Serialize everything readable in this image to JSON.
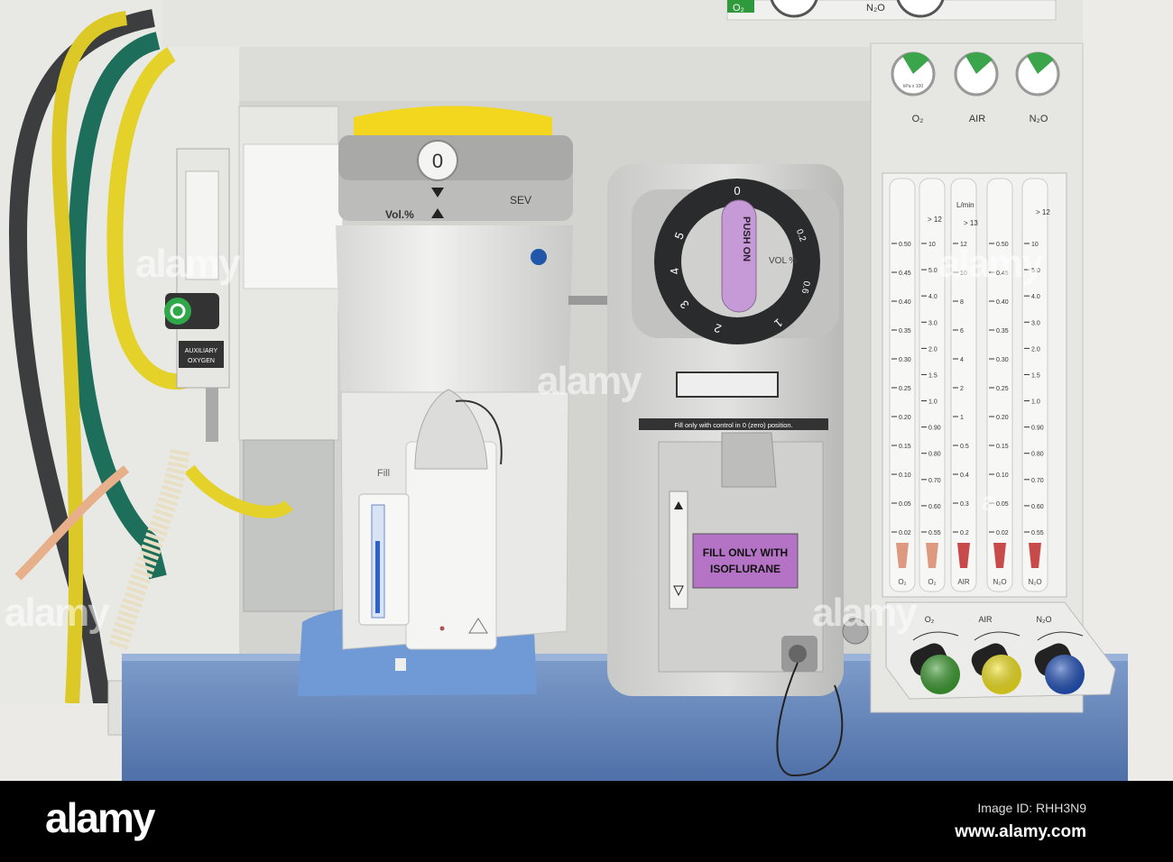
{
  "top_panel": {
    "gauge_labels": [
      "O₂",
      "N₂O"
    ]
  },
  "pipeline_gauges": {
    "labels": [
      "O₂",
      "AIR",
      "N₂O"
    ],
    "unit_text": "kPa x 100"
  },
  "aux_oxygen": {
    "label_line1": "AUXILIARY",
    "label_line2": "OXYGEN"
  },
  "sev_vaporizer": {
    "dial_value": "0",
    "vol_label": "Vol.%",
    "agent": "SEV",
    "fill_label": "Fill"
  },
  "iso_vaporizer": {
    "knob_label": "PUSH ON",
    "vol_label": "VOL %",
    "dial_numbers": [
      "0",
      "0.2",
      "0.6",
      "1",
      "2",
      "3",
      "4",
      "5"
    ],
    "fill_instruction": "Fill only with control in 0 (zero) position.",
    "agent_label_line1": "FILL ONLY WITH",
    "agent_label_line2": "ISOFLURANE"
  },
  "flowmeters": {
    "unit": "L/min",
    "top_marks": [
      "> 12",
      "> 13",
      "> 12"
    ],
    "tube_labels": [
      "O₂",
      "O₂",
      "AIR",
      "N₂O",
      "N₂O"
    ],
    "scales": [
      [
        "0.50",
        "0.45",
        "0.40",
        "0.35",
        "0.30",
        "0.25",
        "0.20",
        "0.15",
        "0.10",
        "0.05",
        "0.02"
      ],
      [
        "10",
        "5.0",
        "4.0",
        "3.0",
        "2.0",
        "1.5",
        "1.0",
        "0.90",
        "0.80",
        "0.70",
        "0.60",
        "0.55"
      ],
      [
        "12",
        "10",
        "8",
        "6",
        "4",
        "2",
        "1",
        "0.5",
        "0.4",
        "0.3",
        "0.2"
      ],
      [
        "0.50",
        "0.45",
        "0.40",
        "0.35",
        "0.30",
        "0.25",
        "0.20",
        "0.15",
        "0.10",
        "0.05",
        "0.02"
      ],
      [
        "10",
        "5.0",
        "4.0",
        "3.0",
        "2.0",
        "1.5",
        "1.0",
        "0.90",
        "0.80",
        "0.70",
        "0.60",
        "0.55"
      ]
    ]
  },
  "flow_knobs": {
    "labels": [
      "O₂",
      "AIR",
      "N₂O"
    ],
    "colors": [
      "#3a9a2e",
      "#f2e21a",
      "#1f4fb8"
    ]
  },
  "watermark": {
    "text": "alamy",
    "small": "a"
  },
  "footer": {
    "logo": "alamy",
    "image_id": "Image ID: RHH3N9",
    "url": "www.alamy.com"
  }
}
